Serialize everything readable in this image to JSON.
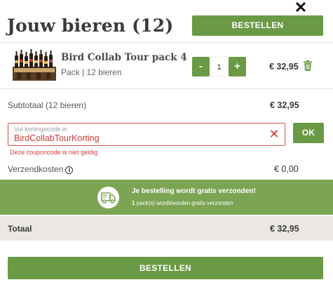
{
  "header": {
    "title": "Jouw bieren (12)",
    "order_label": "BESTELLEN",
    "close_glyph": "✕"
  },
  "cart_item": {
    "name": "Bird Collab Tour pack 4",
    "subtitle": "Pack | 12 bieren",
    "quantity": "1",
    "decrement_label": "-",
    "increment_label": "+",
    "price": "€ 32,95"
  },
  "subtotal": {
    "label_prefix": "Subtotaal (",
    "count": "12 bieren",
    "label_suffix": ")",
    "price": "€ 32,95"
  },
  "coupon": {
    "placeholder": "Vul kortingscode in",
    "value": "BirdCollabTourKorting",
    "clear_glyph": "✕",
    "ok_label": "OK",
    "error": "Deze couponcode is niet geldig"
  },
  "shipping": {
    "label": "Verzendkosten",
    "info_glyph": "i",
    "price": "€ 0,00"
  },
  "banner": {
    "title": "Je bestelling wordt gratis verzonden!",
    "count": "1",
    "subtitle": " pack(s) wordt/worden gratis verzonden"
  },
  "total": {
    "label": "Totaal",
    "price": "€ 32,95"
  },
  "footer": {
    "order_label": "BESTELLEN"
  },
  "colors": {
    "accent": "#6a9a45",
    "banner": "#7ba453",
    "error": "#d13b36",
    "total_bg": "#ebe8e3"
  }
}
